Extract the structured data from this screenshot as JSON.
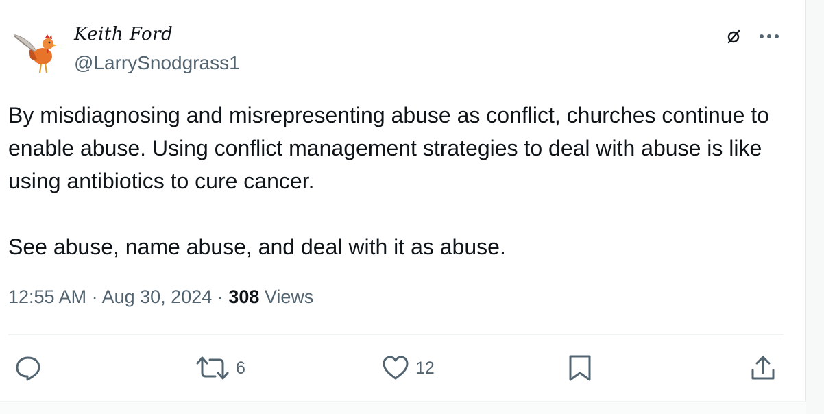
{
  "tweet": {
    "display_name": "Keith Ford",
    "handle": "@LarrySnodgrass1",
    "paragraphs": [
      "By misdiagnosing and misrepresenting abuse as conflict, churches continue to enable abuse. Using conflict management strategies to deal with abuse is like using antibiotics to cure cancer.",
      "See abuse, name abuse, and deal with it as abuse."
    ],
    "time": "12:55 AM",
    "date": "Aug 30, 2024",
    "views_count": "308",
    "views_label": "Views",
    "separator": "·"
  },
  "actions": {
    "retweets": "6",
    "likes": "12"
  },
  "icons": {
    "avatar": "rooster-with-feather-avatar",
    "grok": "grok-icon",
    "more": "more-dots-icon",
    "reply": "reply-bubble-icon",
    "retweet": "retweet-icon",
    "like": "heart-icon",
    "bookmark": "bookmark-icon",
    "share": "share-upload-icon"
  },
  "colors": {
    "text": "#0f1419",
    "secondary": "#536471",
    "divider": "#eff3f4"
  }
}
